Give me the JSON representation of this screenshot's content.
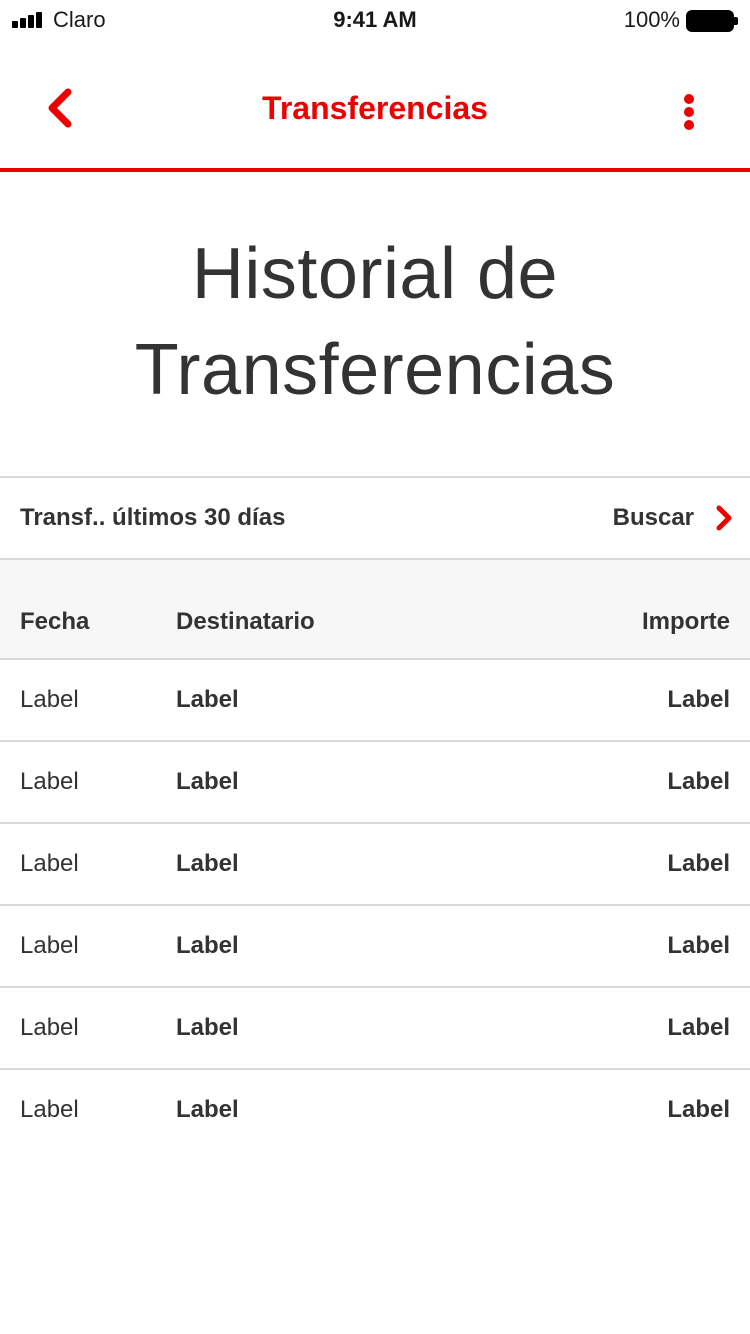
{
  "status_bar": {
    "carrier": "Claro",
    "time": "9:41 AM",
    "battery": "100%"
  },
  "header": {
    "title": "Transferencias",
    "accent_color": "#ec0000"
  },
  "page": {
    "title": "Historial de Transferencias"
  },
  "filter": {
    "label": "Transf.. últimos 30 días",
    "search_label": "Buscar"
  },
  "table": {
    "columns": [
      "Fecha",
      "Destinatario",
      "Importe"
    ],
    "rows": [
      [
        "Label",
        "Label",
        "Label"
      ],
      [
        "Label",
        "Label",
        "Label"
      ],
      [
        "Label",
        "Label",
        "Label"
      ],
      [
        "Label",
        "Label",
        "Label"
      ],
      [
        "Label",
        "Label",
        "Label"
      ],
      [
        "Label",
        "Label",
        "Label"
      ]
    ]
  },
  "icons": {
    "back": "chevron-left-icon",
    "more": "more-vertical-icon",
    "search": "chevron-right-icon"
  }
}
